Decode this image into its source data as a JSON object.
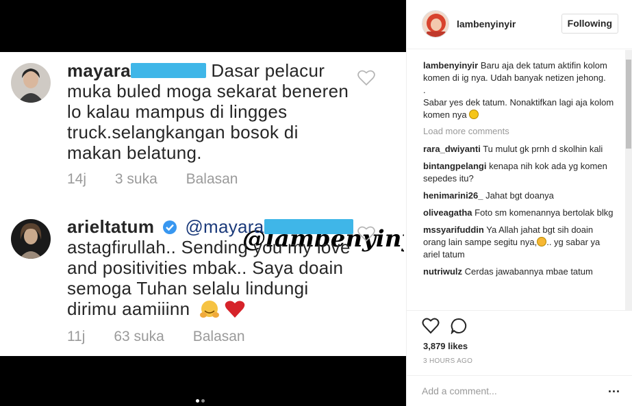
{
  "post": {
    "comment1": {
      "username": "mayara",
      "text": "Dasar pelacur muka buled moga sekarat beneren lo kalau mampus di lingges truck.selangkangan bosok di makan belatung.",
      "time": "14j",
      "likes": "3 suka",
      "reply": "Balasan"
    },
    "watermark": "@lambenyinyir",
    "comment2": {
      "username": "arieltatum",
      "mention": "@mayara",
      "text": "astagfirullah.. Sending you my love and positivities mbak.. Saya doain semoga Tuhan selalu lindungi dirimu aamiiinn",
      "time": "11j",
      "likes": "63 suka",
      "reply": "Balasan"
    },
    "carousel": {
      "count": 2,
      "active": 1
    }
  },
  "sidebar": {
    "username": "lambenyinyir",
    "follow_label": "Following",
    "caption": {
      "username": "lambenyinyir",
      "line1": "Baru aja dek tatum aktifin kolom komen di ig nya. Udah banyak netizen jehong.",
      "line2": ".",
      "line3": "Sabar yes dek tatum. Nonaktifkan lagi aja kolom komen nya"
    },
    "load_more": "Load more comments",
    "comments": [
      {
        "user": "rara_dwiyanti",
        "text": "Tu mulut gk prnh d skolhin kali"
      },
      {
        "user": "bintangpelangi",
        "text": "kenapa nih kok ada yg komen sepedes itu?"
      },
      {
        "user": "henimarini26_",
        "text": "Jahat bgt doanya"
      },
      {
        "user": "oliveagatha",
        "text": "Foto sm komenannya bertolak blkg"
      },
      {
        "user": "mssyarifuddin",
        "text": "Ya Allah jahat bgt sih doain orang lain sampe segitu nya,",
        "text2": ".. yg sabar ya ariel tatum"
      },
      {
        "user": "nutriwulz",
        "text": "Cerdas jawabannya mbae tatum"
      }
    ],
    "likes": "3,879 likes",
    "time": "3 HOURS AGO",
    "add_comment_placeholder": "Add a comment...",
    "more_label": "..."
  },
  "icons": [
    "heart-icon",
    "comment-icon",
    "verified-badge-icon",
    "more-options-icon"
  ],
  "colors": {
    "accent_blur": "#3fb6e8",
    "verified": "#3897f0",
    "text": "#262626",
    "muted": "#999999"
  }
}
